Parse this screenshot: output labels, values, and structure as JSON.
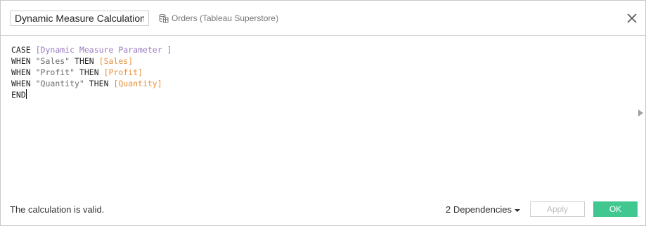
{
  "dialog": {
    "calc_name": "Dynamic Measure Calculation",
    "datasource_label": "Orders (Tableau Superstore)",
    "datasource_icon": "datasource-icon",
    "close_icon": "close-icon"
  },
  "editor": {
    "lines": [
      [
        {
          "t": "CASE ",
          "c": "kw"
        },
        {
          "t": "[Dynamic Measure Parameter ]",
          "c": "param"
        }
      ],
      [
        {
          "t": "WHEN ",
          "c": "kw"
        },
        {
          "t": "\"Sales\"",
          "c": "str"
        },
        {
          "t": " THEN ",
          "c": "kw"
        },
        {
          "t": "[Sales]",
          "c": "field"
        }
      ],
      [
        {
          "t": "WHEN ",
          "c": "kw"
        },
        {
          "t": "\"Profit\"",
          "c": "str"
        },
        {
          "t": " THEN ",
          "c": "kw"
        },
        {
          "t": "[Profit]",
          "c": "field"
        }
      ],
      [
        {
          "t": "WHEN ",
          "c": "kw"
        },
        {
          "t": "\"Quantity\"",
          "c": "str"
        },
        {
          "t": " THEN ",
          "c": "kw"
        },
        {
          "t": "[Quantity]",
          "c": "field"
        }
      ],
      [
        {
          "t": "END",
          "c": "kw"
        }
      ]
    ],
    "colors": {
      "keyword": "#1f1f1f",
      "string": "#6d6d6d",
      "parameter": "#9b7bbf",
      "field": "#e8923a"
    }
  },
  "footer": {
    "status": "The calculation is valid.",
    "dependencies": "2 Dependencies",
    "apply_label": "Apply",
    "ok_label": "OK",
    "ok_color": "#41c891"
  }
}
